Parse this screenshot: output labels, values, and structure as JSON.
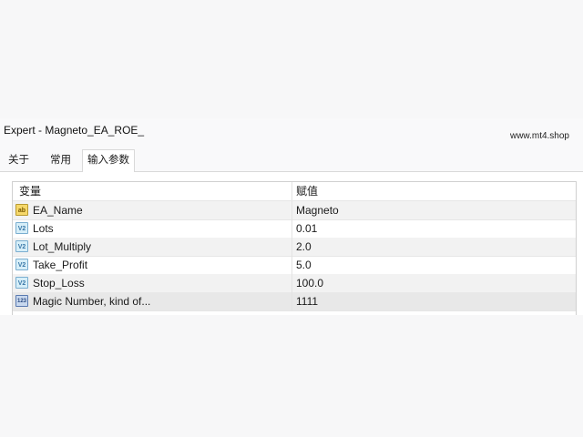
{
  "window": {
    "title": "Expert - Magneto_EA_ROE_",
    "watermark": "www.mt4.shop"
  },
  "tabs": [
    {
      "label": "关于",
      "active": false
    },
    {
      "label": "常用",
      "active": false
    },
    {
      "label": "输入参数",
      "active": true
    }
  ],
  "table": {
    "columns": [
      "变量",
      "赋值"
    ],
    "rows": [
      {
        "icon": "string-type-icon",
        "name": "EA_Name",
        "value": "Magneto"
      },
      {
        "icon": "double-type-icon",
        "name": "Lots",
        "value": "0.01"
      },
      {
        "icon": "double-type-icon",
        "name": "Lot_Multiply",
        "value": "2.0"
      },
      {
        "icon": "double-type-icon",
        "name": "Take_Profit",
        "value": "5.0"
      },
      {
        "icon": "double-type-icon",
        "name": "Stop_Loss",
        "value": "100.0"
      },
      {
        "icon": "integer-type-icon",
        "name": "Magic Number, kind of...",
        "value": "1111"
      }
    ]
  },
  "colors": {
    "panel": "#ffffff",
    "shaded_row": "#f2f2f2",
    "grid_line": "#e6e6e6"
  }
}
